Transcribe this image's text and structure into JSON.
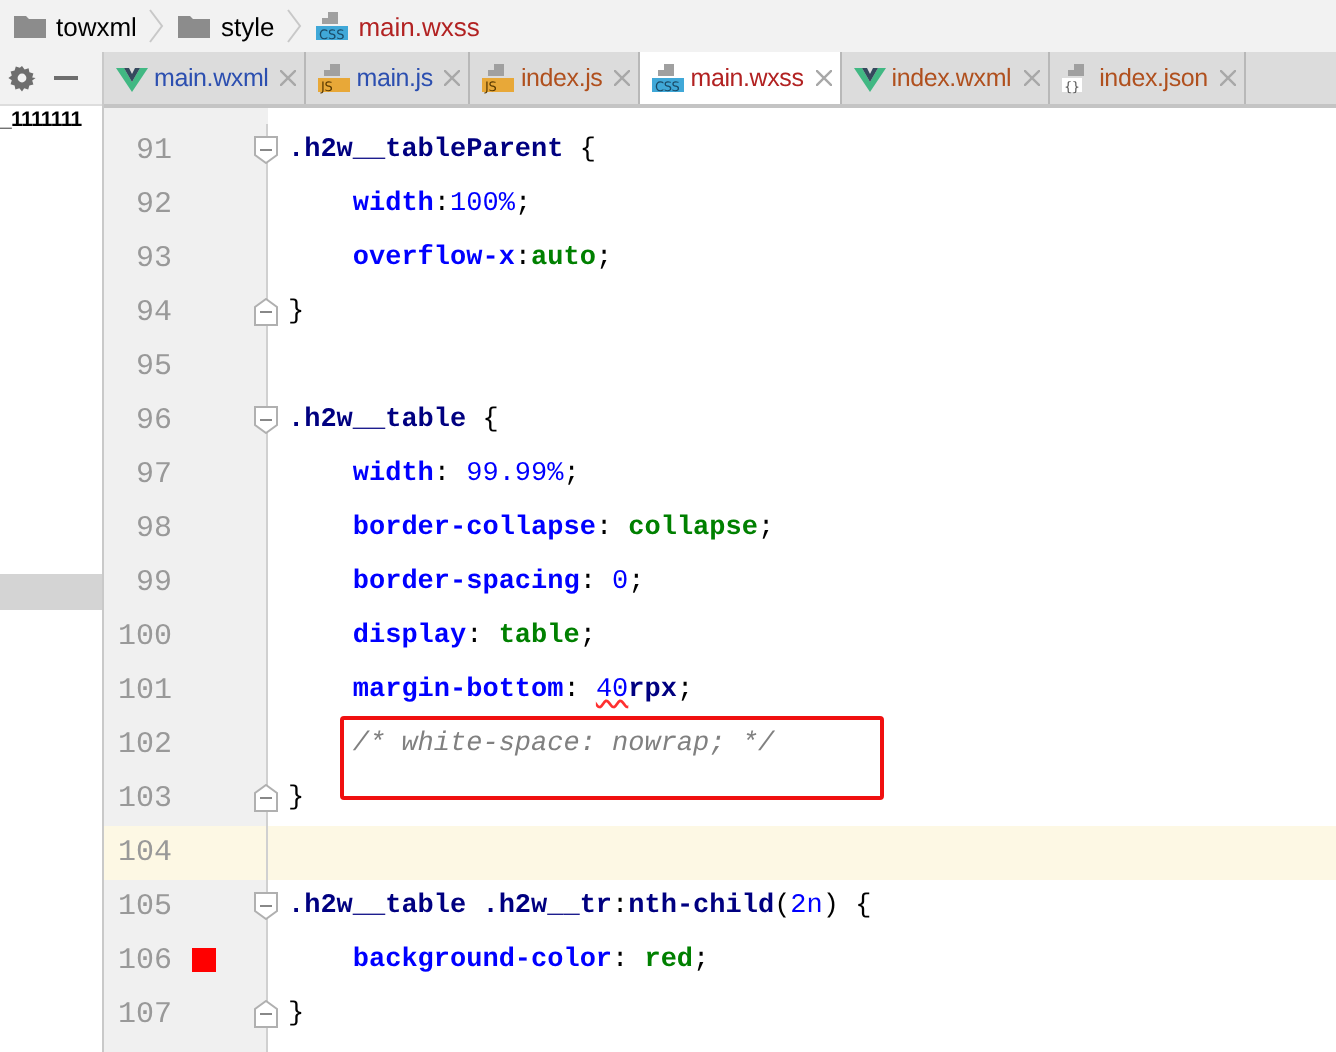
{
  "breadcrumb": [
    {
      "label": "towxml",
      "kind": "folder",
      "color": "#000000"
    },
    {
      "label": "style",
      "kind": "folder",
      "color": "#000000"
    },
    {
      "label": "main.wxss",
      "kind": "css",
      "icon_label": "CSS",
      "color": "#b22222"
    }
  ],
  "side_panel": {
    "rows": [
      {
        "label": "_1111111",
        "selected": false
      },
      {
        "selected": true
      }
    ]
  },
  "tabs": [
    {
      "label": "main.wxml",
      "kind": "vue",
      "color": "#2c4fb0",
      "selected": false
    },
    {
      "label": "main.js",
      "kind": "js",
      "icon_label": "JS",
      "color": "#2c4fb0",
      "selected": false
    },
    {
      "label": "index.js",
      "kind": "js",
      "icon_label": "JS",
      "color": "#b0501e",
      "selected": false
    },
    {
      "label": "main.wxss",
      "kind": "css",
      "icon_label": "CSS",
      "color": "#b22222",
      "selected": true
    },
    {
      "label": "index.wxml",
      "kind": "vue",
      "color": "#b0501e",
      "selected": false
    },
    {
      "label": "index.json",
      "kind": "json",
      "icon_label": "{}",
      "color": "#b0501e",
      "selected": false
    }
  ],
  "lines": [
    {
      "number": "91",
      "fold_open": true,
      "tokens": [
        {
          "kind": "sel",
          "text": ".h2w__tableParent"
        },
        {
          "kind": "punct",
          "text": " {"
        }
      ]
    },
    {
      "number": "92",
      "tokens": [
        {
          "kind": "prop",
          "text": "    width"
        },
        {
          "kind": "punct",
          "text": ":"
        },
        {
          "kind": "num",
          "text": "100%"
        },
        {
          "kind": "punct",
          "text": ";"
        }
      ]
    },
    {
      "number": "93",
      "tokens": [
        {
          "kind": "prop",
          "text": "    overflow-x"
        },
        {
          "kind": "punct",
          "text": ":"
        },
        {
          "kind": "val",
          "text": "auto"
        },
        {
          "kind": "punct",
          "text": ";"
        }
      ]
    },
    {
      "number": "94",
      "fold_close": true,
      "tokens": [
        {
          "kind": "punct",
          "text": "}"
        }
      ]
    },
    {
      "number": "95"
    },
    {
      "number": "96",
      "fold_open": true,
      "tokens": [
        {
          "kind": "sel",
          "text": ".h2w__table"
        },
        {
          "kind": "punct",
          "text": " {"
        }
      ]
    },
    {
      "number": "97",
      "tokens": [
        {
          "kind": "prop",
          "text": "    width"
        },
        {
          "kind": "punct",
          "text": ": "
        },
        {
          "kind": "num",
          "text": "99.99%"
        },
        {
          "kind": "punct",
          "text": ";"
        }
      ]
    },
    {
      "number": "98",
      "tokens": [
        {
          "kind": "prop",
          "text": "    border-collapse"
        },
        {
          "kind": "punct",
          "text": ": "
        },
        {
          "kind": "val",
          "text": "collapse"
        },
        {
          "kind": "punct",
          "text": ";"
        }
      ]
    },
    {
      "number": "99",
      "tokens": [
        {
          "kind": "prop",
          "text": "    border-spacing"
        },
        {
          "kind": "punct",
          "text": ": "
        },
        {
          "kind": "num",
          "text": "0"
        },
        {
          "kind": "punct",
          "text": ";"
        }
      ]
    },
    {
      "number": "100",
      "tokens": [
        {
          "kind": "prop",
          "text": "    display"
        },
        {
          "kind": "punct",
          "text": ": "
        },
        {
          "kind": "val",
          "text": "table"
        },
        {
          "kind": "punct",
          "text": ";"
        }
      ]
    },
    {
      "number": "101",
      "tokens": [
        {
          "kind": "prop",
          "text": "    margin-bottom"
        },
        {
          "kind": "punct",
          "text": ": "
        },
        {
          "kind": "num_warning",
          "text": "40"
        },
        {
          "kind": "sel",
          "text": "rpx"
        },
        {
          "kind": "punct",
          "text": ";"
        }
      ]
    },
    {
      "number": "102",
      "boxed": true,
      "tokens": [
        {
          "kind": "comment",
          "text": "    /* white-space: nowrap; */"
        }
      ]
    },
    {
      "number": "103",
      "fold_close": true,
      "tokens": [
        {
          "kind": "punct",
          "text": "}"
        }
      ]
    },
    {
      "number": "104",
      "current": true
    },
    {
      "number": "105",
      "fold_open": true,
      "tokens": [
        {
          "kind": "sel",
          "text": ".h2w__table .h2w__tr"
        },
        {
          "kind": "punct",
          "text": ":"
        },
        {
          "kind": "sel",
          "text": "nth-child"
        },
        {
          "kind": "punct",
          "text": "("
        },
        {
          "kind": "num",
          "text": "2n"
        },
        {
          "kind": "punct",
          "text": ") {"
        }
      ]
    },
    {
      "number": "106",
      "color": "#ff0000",
      "tokens": [
        {
          "kind": "prop",
          "text": "    background-color"
        },
        {
          "kind": "punct",
          "text": ": "
        },
        {
          "kind": "val",
          "text": "red"
        },
        {
          "kind": "punct",
          "text": ";"
        }
      ]
    },
    {
      "number": "107",
      "fold_close": true,
      "tokens": [
        {
          "kind": "punct",
          "text": "}"
        }
      ]
    }
  ]
}
